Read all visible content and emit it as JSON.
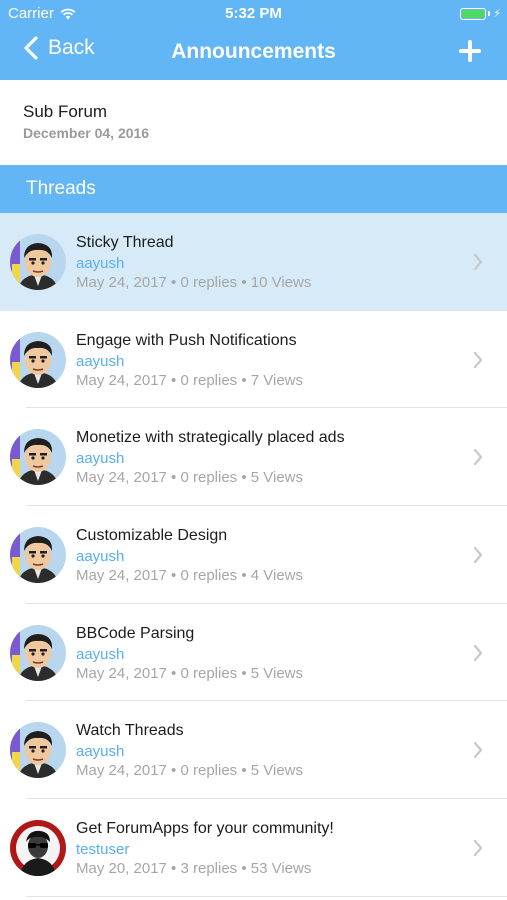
{
  "status_bar": {
    "carrier": "Carrier",
    "time": "5:32 PM",
    "battery_color": "#4cd964"
  },
  "nav": {
    "back_label": "Back",
    "title": "Announcements",
    "add_icon": "plus-icon",
    "color": "#62b6f5"
  },
  "subforum": {
    "title": "Sub Forum",
    "date": "December 04, 2016"
  },
  "section": {
    "label": "Threads"
  },
  "threads": [
    {
      "title": "Sticky Thread",
      "user": "aayush",
      "meta": "May 24, 2017 • 0 replies • 10 Views",
      "avatar": "cartoon-avatar",
      "highlighted": true
    },
    {
      "title": "Engage with Push Notifications",
      "user": "aayush",
      "meta": "May 24, 2017 • 0 replies • 7 Views",
      "avatar": "cartoon-avatar"
    },
    {
      "title": "Monetize with strategically placed ads",
      "user": "aayush",
      "meta": "May 24, 2017 • 0 replies • 5 Views",
      "avatar": "cartoon-avatar"
    },
    {
      "title": "Customizable Design",
      "user": "aayush",
      "meta": "May 24, 2017 • 0 replies • 4 Views",
      "avatar": "cartoon-avatar"
    },
    {
      "title": "BBCode Parsing",
      "user": "aayush",
      "meta": "May 24, 2017 • 0 replies • 5 Views",
      "avatar": "cartoon-avatar"
    },
    {
      "title": "Watch Threads",
      "user": "aayush",
      "meta": "May 24, 2017 • 0 replies • 5 Views",
      "avatar": "cartoon-avatar"
    },
    {
      "title": "Get ForumApps for your community!",
      "user": "testuser",
      "meta": "May 20, 2017 • 3 replies • 53 Views",
      "avatar": "sunglasses-avatar"
    }
  ]
}
